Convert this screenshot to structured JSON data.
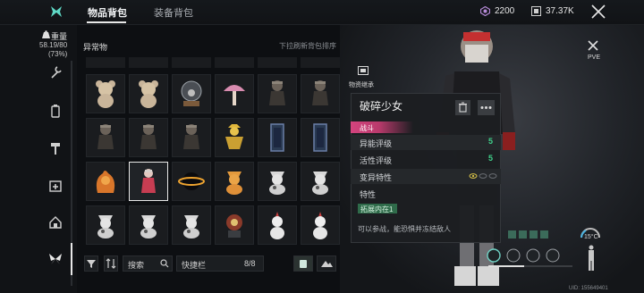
{
  "header": {
    "tabs": [
      {
        "label": "物品背包",
        "active": true
      },
      {
        "label": "装备背包",
        "active": false
      }
    ],
    "currency_gems": "2200",
    "currency_coins": "37.37K"
  },
  "weight": {
    "label": "重量",
    "value": "58.19/80",
    "percent": "(73%)"
  },
  "rail": {
    "icons": [
      "wrench-icon",
      "canister-icon",
      "hammer-icon",
      "med-kit-icon",
      "home-icon",
      "butterfly-icon"
    ]
  },
  "inventory": {
    "section_title": "异常物",
    "hint": "下拉刷新背包排序",
    "rows": [
      [
        "teddy-bear",
        "teddy-bear",
        "snow-globe",
        "mushroom-lamp",
        "dark-doll",
        "dark-doll"
      ],
      [
        "dark-doll",
        "dark-doll",
        "dark-doll",
        "scarecrow",
        "mirror-frame",
        "mirror-frame"
      ],
      [
        "flame-cat",
        "broken-girl",
        "black-hole",
        "orange-cat",
        "white-cat",
        "white-cat"
      ],
      [
        "white-cat",
        "white-cat",
        "white-cat",
        "robot-doll",
        "white-plush",
        "white-plush"
      ]
    ],
    "selected_index": 13
  },
  "bottom_bar": {
    "search_label": "搜索",
    "quick_label": "快捷栏",
    "quick_count": "8/8"
  },
  "detail": {
    "side_label": "物资继承",
    "name": "破碎少女",
    "tag": "战斗",
    "rows": [
      {
        "label": "异能评级",
        "value": "5"
      },
      {
        "label": "活性评级",
        "value": "5"
      },
      {
        "label": "变异特性",
        "value": ""
      }
    ],
    "trait_header": "特性",
    "trait_name": "拓展内在1",
    "description": "可以参战，能恐惧并冻结敌人"
  },
  "hud": {
    "mode": "PVE",
    "temperature": "15°C",
    "uid": "UID: 155649401"
  },
  "colors": {
    "accent_green": "#3fd08a",
    "tag_pink": "#d4447e",
    "selected_border": "#e8e8e8"
  }
}
